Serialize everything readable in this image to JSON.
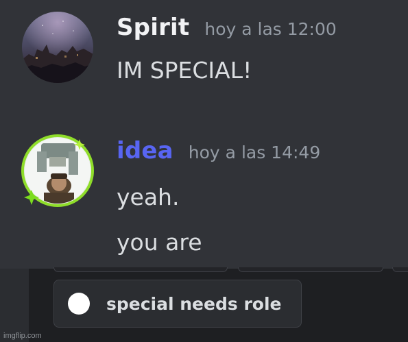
{
  "messages": [
    {
      "username": "Spirit",
      "username_color": "#f2f3f5",
      "timestamp": "hoy a las 12:00",
      "lines": [
        "IM SPECIAL!"
      ],
      "avatar": "night-sky-city-avatar"
    },
    {
      "username": "idea",
      "username_color": "#5865f2",
      "timestamp": "hoy a las 14:49",
      "lines": [
        "yeah.",
        "you are"
      ],
      "avatar": "pirate-with-sparkle-frame-avatar",
      "avatar_decoration_color": "#8fdd2a"
    }
  ],
  "role": {
    "label": "special needs role",
    "color": "#ffffff"
  },
  "watermark": "imgflip.com"
}
